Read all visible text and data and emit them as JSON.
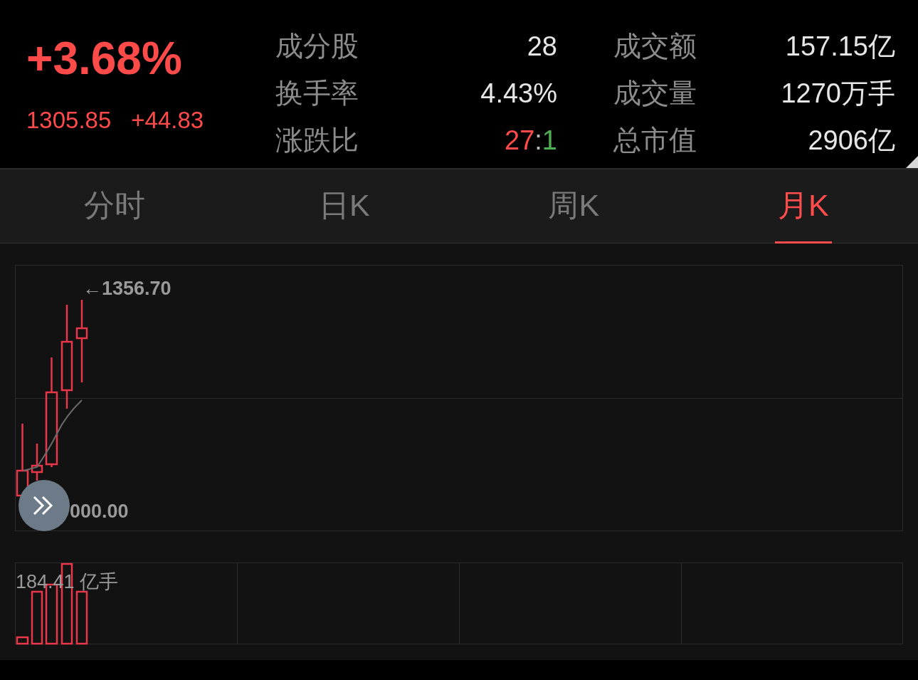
{
  "summary": {
    "change_percent": "+3.68%",
    "price": "1305.85",
    "change": "+44.83"
  },
  "stats": [
    {
      "label": "成分股",
      "value": "28"
    },
    {
      "label": "成交额",
      "value": "157.15亿"
    },
    {
      "label": "换手率",
      "value": "4.43%"
    },
    {
      "label": "成交量",
      "value": "1270万手"
    },
    {
      "label": "涨跌比",
      "parts": [
        {
          "text": "27",
          "kind": "up"
        },
        {
          "text": ":",
          "kind": "sep"
        },
        {
          "text": "1",
          "kind": "down"
        }
      ]
    },
    {
      "label": "总市值",
      "value": "2906亿"
    }
  ],
  "tabs": [
    {
      "label": "分时",
      "selected": false
    },
    {
      "label": "日K",
      "selected": false
    },
    {
      "label": "周K",
      "selected": false
    },
    {
      "label": "月K",
      "selected": true
    }
  ],
  "chart": {
    "high_label": "←1356.70",
    "low_label": "000.00",
    "volume_label": "184.41 亿手"
  }
}
